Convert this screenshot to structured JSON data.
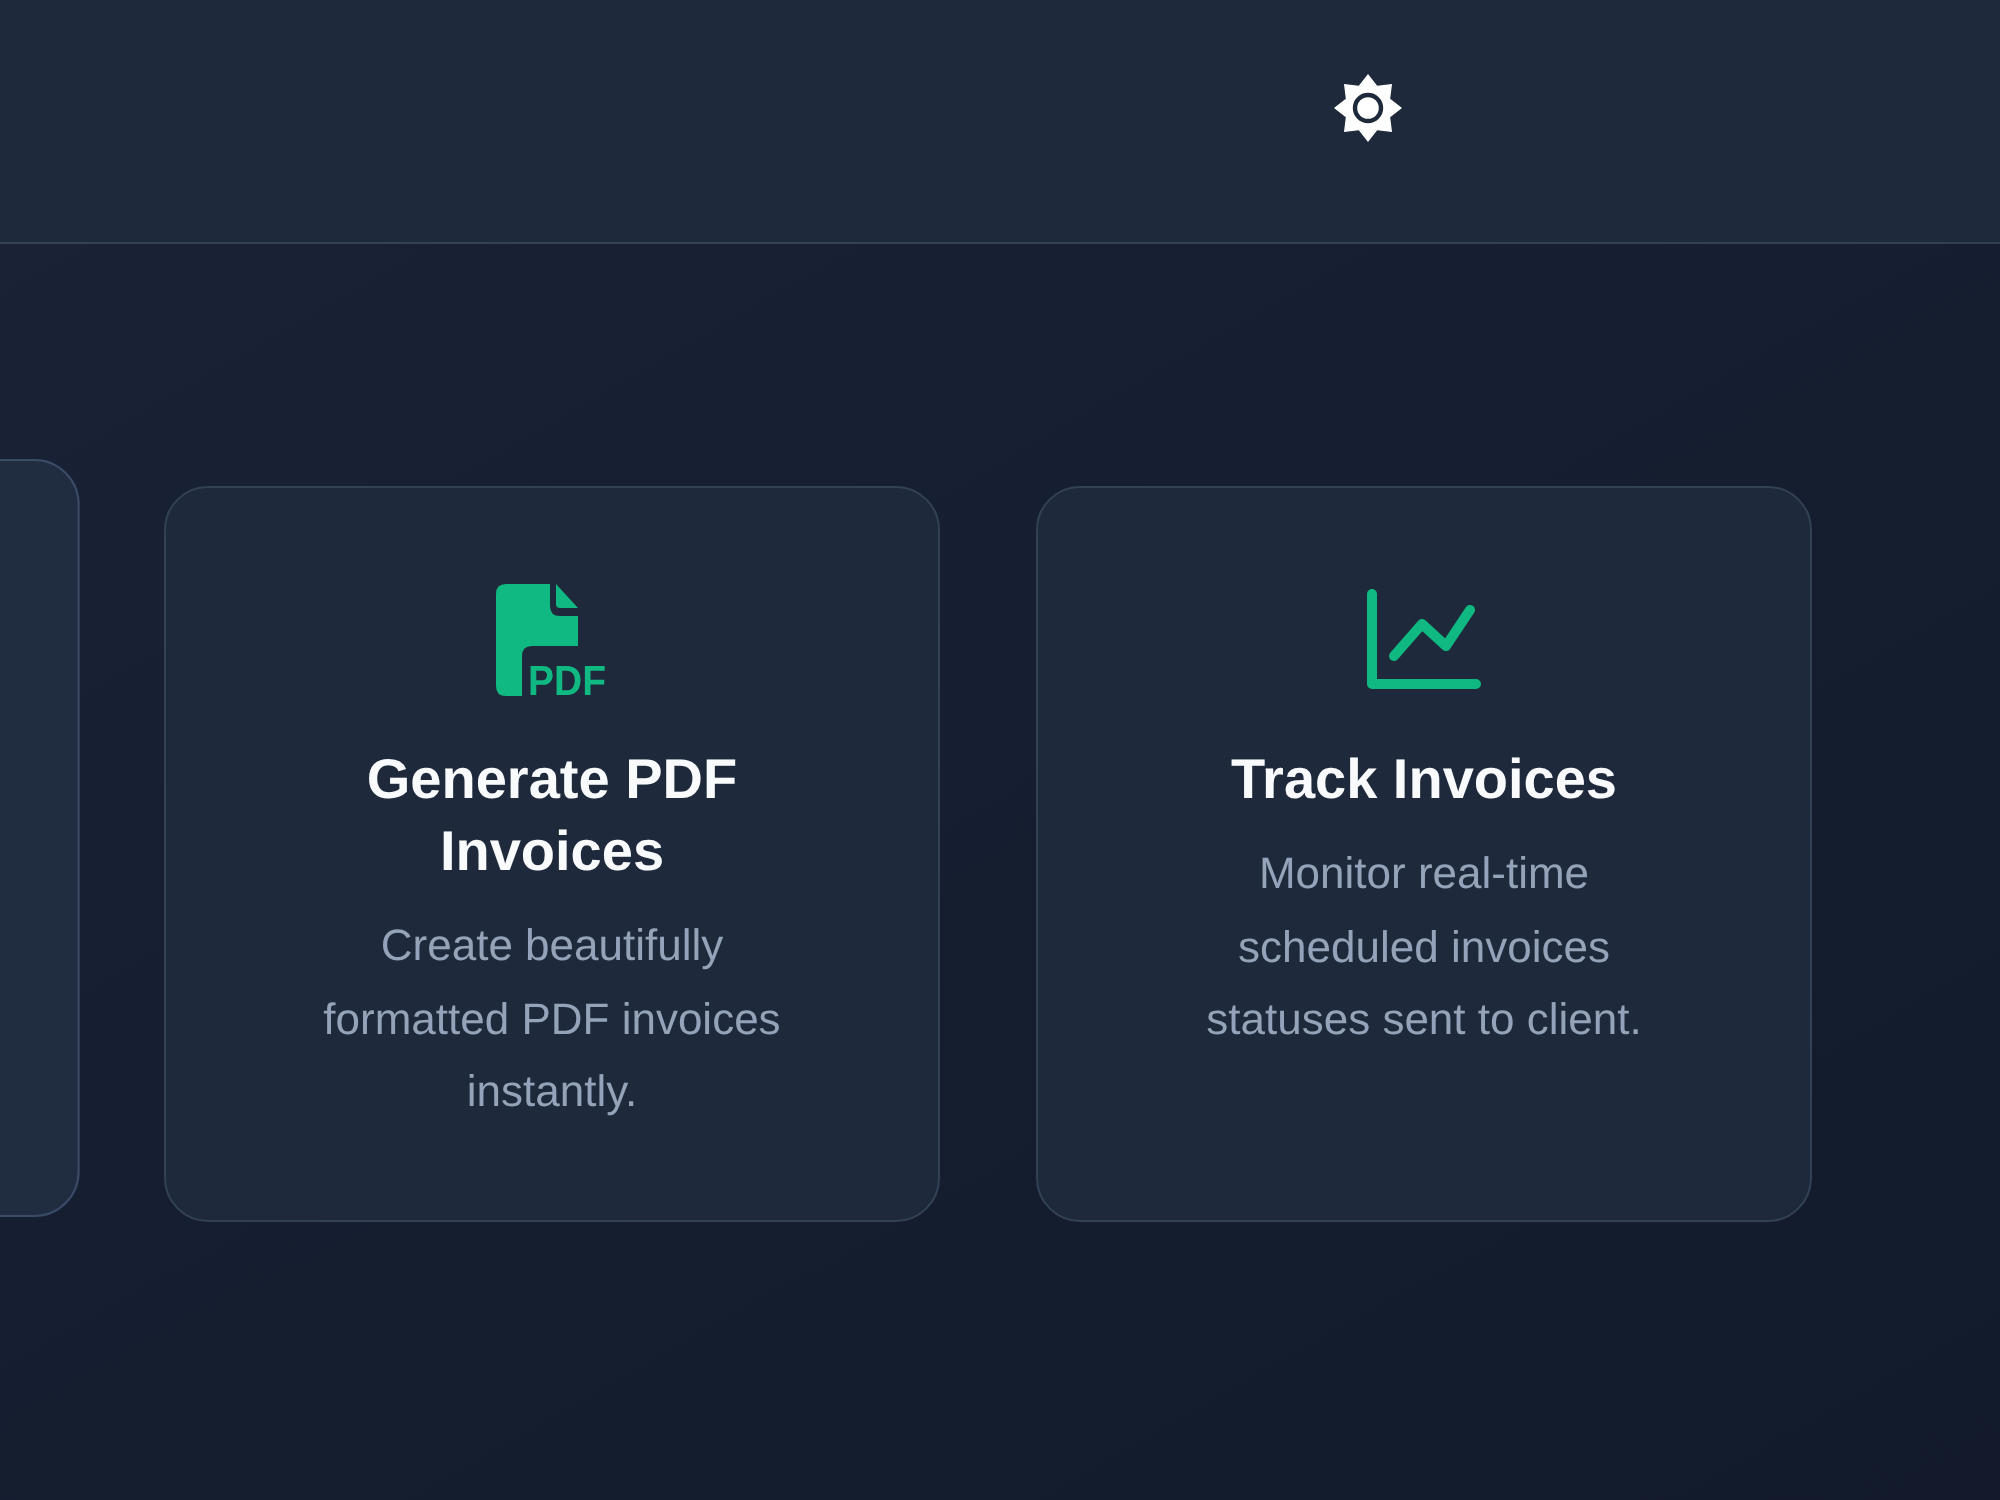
{
  "features": [
    {
      "hovered": true
    },
    {
      "title": "Generate PDF Invoices",
      "description": "Create beautifully formatted PDF invoices instantly.",
      "icon_text": "PDF",
      "hovered": false
    },
    {
      "title": "Track Invoices",
      "description": "Monitor real-time scheduled invoices statuses sent to client.",
      "hovered": false
    }
  ]
}
